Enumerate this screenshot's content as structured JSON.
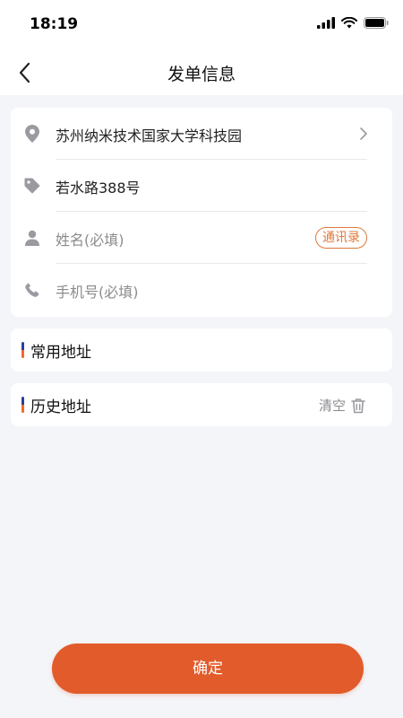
{
  "status_bar": {
    "time": "18:19"
  },
  "nav": {
    "title": "发单信息"
  },
  "form": {
    "address": "苏州纳米技术国家大学科技园",
    "street": "若水路388号",
    "name_placeholder": "姓名(必填)",
    "contacts_button": "通讯录",
    "phone_placeholder": "手机号(必填)"
  },
  "sections": {
    "common_address": "常用地址",
    "history_address": "历史地址",
    "clear_label": "清空"
  },
  "confirm": {
    "label": "确定"
  },
  "colors": {
    "accent": "#e25b2a",
    "contacts_border": "#e0783a",
    "marker_blue": "#2a3f99",
    "marker_orange": "#f26a2a"
  },
  "icons": [
    "location-pin-icon",
    "tag-icon",
    "person-icon",
    "phone-icon",
    "chevron-right-icon",
    "trash-icon",
    "back-arrow-icon"
  ]
}
